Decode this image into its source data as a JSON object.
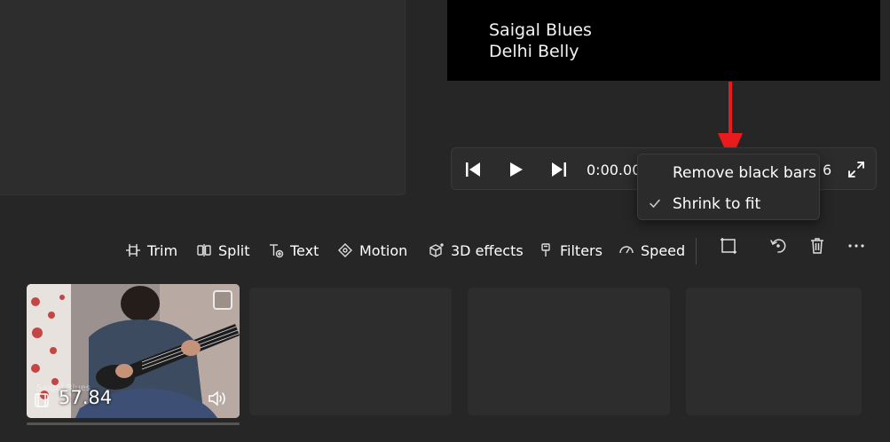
{
  "preview": {
    "lines": [
      "Saigal Blues",
      "Delhi Belly"
    ]
  },
  "player": {
    "current_time": "0:00.00",
    "end_time_partial": "6",
    "icons": {
      "previous": "skip-back-icon",
      "play": "play-icon",
      "next": "skip-forward-icon",
      "fullscreen": "fullscreen-icon"
    }
  },
  "aspect_menu": {
    "items": [
      {
        "label": "Remove black bars",
        "checked": false
      },
      {
        "label": "Shrink to fit",
        "checked": true
      }
    ]
  },
  "toolbar": {
    "trim": "Trim",
    "split": "Split",
    "text": "Text",
    "motion": "Motion",
    "effects_3d": "3D effects",
    "filters": "Filters",
    "speed": "Speed"
  },
  "storyboard": {
    "clip": {
      "duration": "57.84",
      "faint_text": "Saigal Blues"
    }
  },
  "colors": {
    "accent_arrow": "#e81c1c",
    "background": "#262626",
    "panel": "#2d2d2d"
  }
}
